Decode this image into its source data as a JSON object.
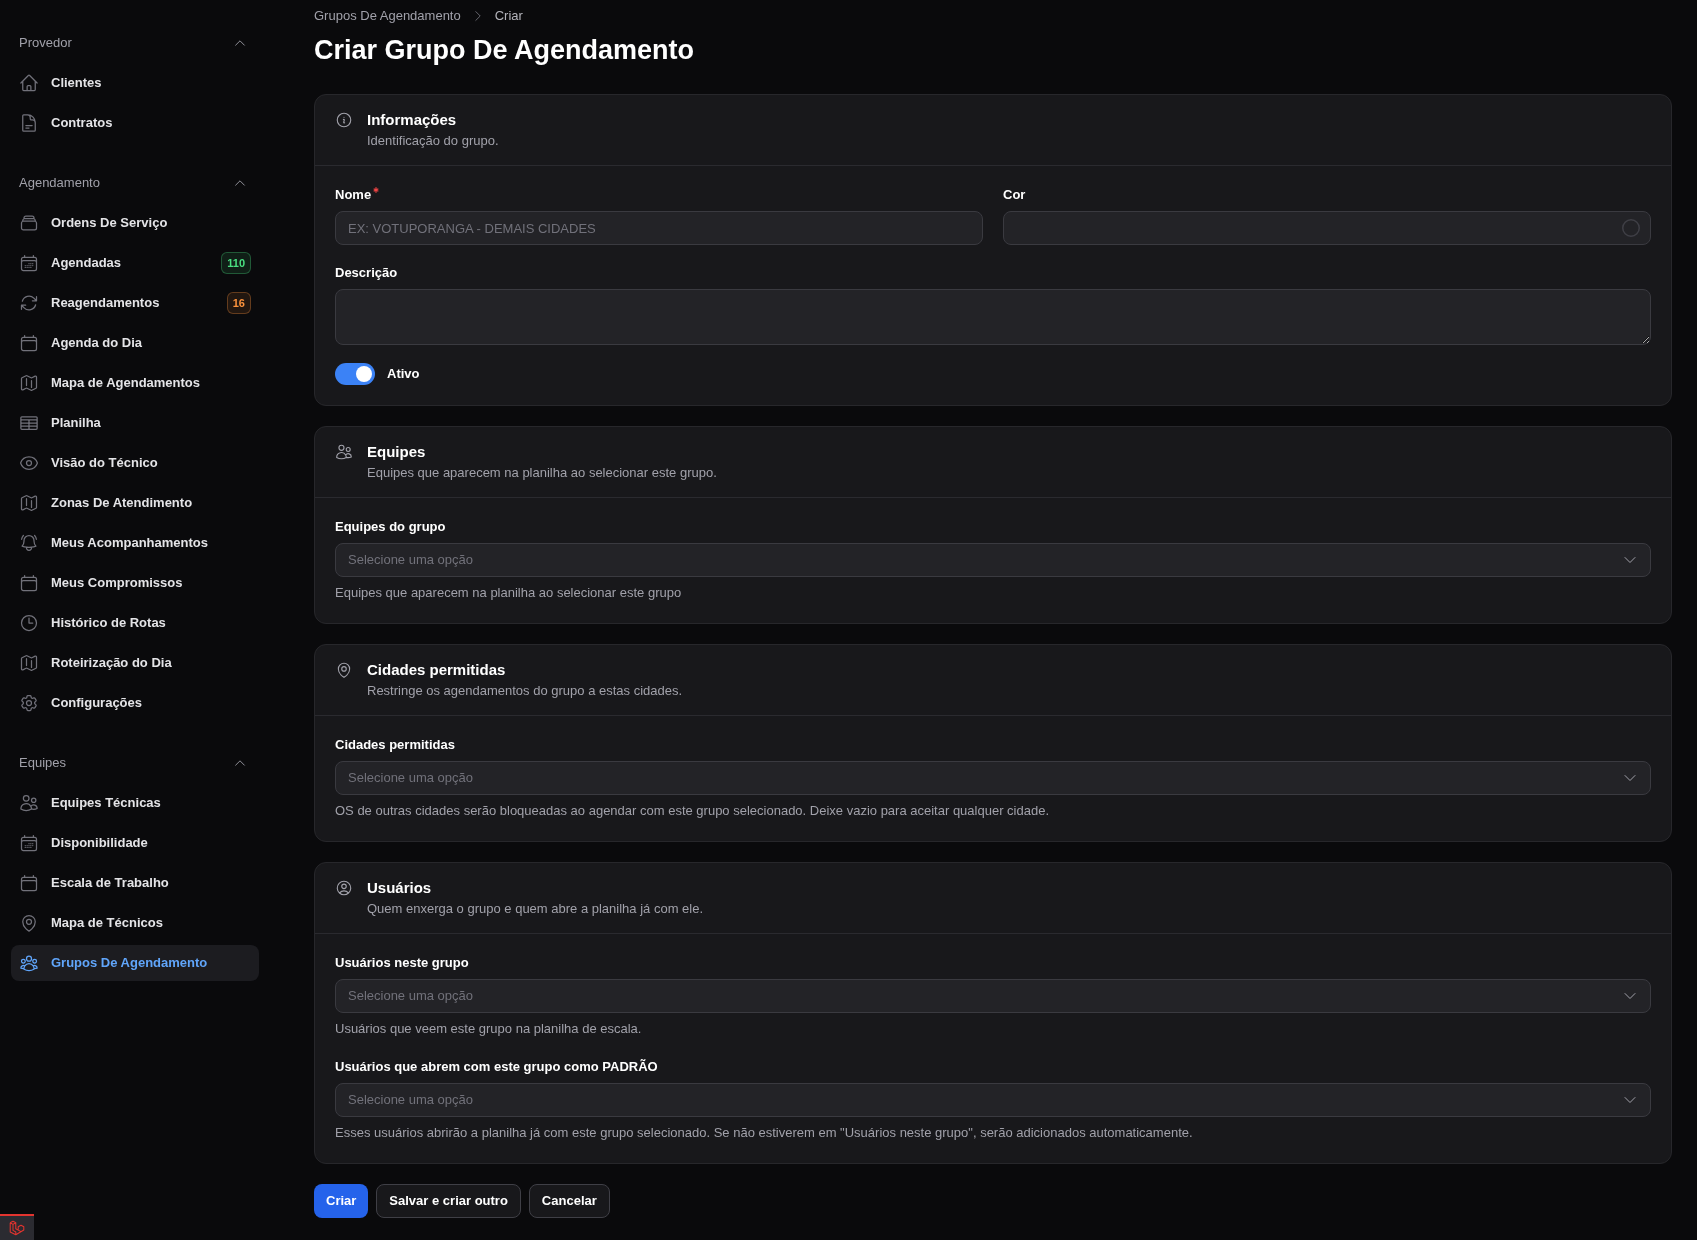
{
  "sidebar": {
    "groups": [
      {
        "label": "Provedor",
        "expanded": true,
        "items": [
          {
            "label": "Clientes",
            "selected": false
          },
          {
            "label": "Contratos",
            "selected": false
          }
        ]
      },
      {
        "label": "Agendamento",
        "expanded": true,
        "items": [
          {
            "label": "Ordens De Serviço",
            "selected": false
          },
          {
            "label": "Agendadas",
            "selected": false,
            "badge": {
              "text": "110",
              "color": "#4ade80"
            }
          },
          {
            "label": "Reagendamentos",
            "selected": false,
            "badge": {
              "text": "16",
              "color": "#fb923c"
            }
          },
          {
            "label": "Agenda do Dia",
            "selected": false
          },
          {
            "label": "Mapa de Agendamentos",
            "selected": false
          },
          {
            "label": "Planilha",
            "selected": false
          },
          {
            "label": "Visão do Técnico",
            "selected": false
          },
          {
            "label": "Zonas De Atendimento",
            "selected": false
          },
          {
            "label": "Meus Acompanhamentos",
            "selected": false
          },
          {
            "label": "Meus Compromissos",
            "selected": false
          },
          {
            "label": "Histórico de Rotas",
            "selected": false
          },
          {
            "label": "Roteirização do Dia",
            "selected": false
          },
          {
            "label": "Configurações",
            "selected": false
          }
        ]
      },
      {
        "label": "Equipes",
        "expanded": true,
        "items": [
          {
            "label": "Equipes Técnicas",
            "selected": false
          },
          {
            "label": "Disponibilidade",
            "selected": false
          },
          {
            "label": "Escala de Trabalho",
            "selected": false
          },
          {
            "label": "Mapa de Técnicos",
            "selected": false
          },
          {
            "label": "Grupos De Agendamento",
            "selected": true
          }
        ]
      }
    ]
  },
  "breadcrumbs": [
    "Grupos De Agendamento",
    "Criar"
  ],
  "title": "Criar Grupo De Agendamento",
  "sections": [
    {
      "title": "Informações",
      "subtitle": "Identificação do grupo.",
      "rows": [
        [
          {
            "kind": "text",
            "label": "Nome",
            "required": true,
            "placeholder": "EX: VOTUPORANGA - DEMAIS CIDADES"
          },
          {
            "kind": "color",
            "label": "Cor",
            "required": false
          }
        ],
        [
          {
            "kind": "textarea",
            "label": "Descrição",
            "required": false
          }
        ],
        [
          {
            "kind": "toggle",
            "label": "Ativo",
            "required": false,
            "on": true
          }
        ]
      ]
    },
    {
      "title": "Equipes",
      "subtitle": "Equipes que aparecem na planilha ao selecionar este grupo.",
      "rows": [
        [
          {
            "kind": "select",
            "label": "Equipes do grupo",
            "required": false,
            "placeholder": "Selecione uma opção",
            "help": "Equipes que aparecem na planilha ao selecionar este grupo"
          }
        ]
      ]
    },
    {
      "title": "Cidades permitidas",
      "subtitle": "Restringe os agendamentos do grupo a estas cidades.",
      "rows": [
        [
          {
            "kind": "select",
            "label": "Cidades permitidas",
            "required": false,
            "placeholder": "Selecione uma opção",
            "help": "OS de outras cidades serão bloqueadas ao agendar com este grupo selecionado. Deixe vazio para aceitar qualquer cidade."
          }
        ]
      ]
    },
    {
      "title": "Usuários",
      "subtitle": "Quem enxerga o grupo e quem abre a planilha já com ele.",
      "rows": [
        [
          {
            "kind": "select",
            "label": "Usuários neste grupo",
            "required": false,
            "placeholder": "Selecione uma opção",
            "help": "Usuários que veem este grupo na planilha de escala."
          }
        ],
        [
          {
            "kind": "select",
            "label": "Usuários que abrem com este grupo como PADRÃO",
            "required": false,
            "placeholder": "Selecione uma opção",
            "help": "Esses usuários abrirão a planilha já com este grupo selecionado. Se não estiverem em \"Usuários neste grupo\", serão adicionados automaticamente."
          }
        ]
      ]
    }
  ],
  "actions": [
    {
      "label": "Criar",
      "kind": "primary"
    },
    {
      "label": "Salvar e criar outro",
      "kind": "secondary"
    },
    {
      "label": "Cancelar",
      "kind": "secondary"
    }
  ]
}
